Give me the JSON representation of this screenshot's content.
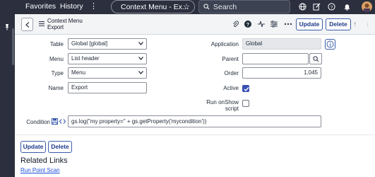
{
  "topnav": {
    "favorites": "Favorites",
    "history": "History",
    "more": "⋮",
    "record_title": "Context Menu - Ex...",
    "search_placeholder": "Search"
  },
  "header": {
    "title_line1": "Context Menu",
    "title_line2": "Export",
    "update_label": "Update",
    "delete_label": "Delete"
  },
  "form": {
    "table": {
      "label": "Table",
      "value": "Global [global]"
    },
    "menu": {
      "label": "Menu",
      "value": "List header"
    },
    "type": {
      "label": "Type",
      "value": "Menu"
    },
    "name": {
      "label": "Name",
      "value": "Export"
    },
    "application": {
      "label": "Application",
      "value": "Global"
    },
    "parent": {
      "label": "Parent",
      "value": ""
    },
    "order": {
      "label": "Order",
      "value": "1,045"
    },
    "active": {
      "label": "Active",
      "checked": true
    },
    "run_onshow": {
      "label_line1": "Run onShow",
      "label_line2": "script",
      "checked": false
    },
    "condition": {
      "label": "Condition",
      "value": "gs.log(\"my property=\" + gs.getProperty('mycondition'))"
    }
  },
  "footer": {
    "update_label": "Update",
    "delete_label": "Delete"
  },
  "related_links": {
    "title": "Related Links",
    "items": [
      "Run Point Scan"
    ]
  },
  "colors": {
    "nav_bg": "#2b2f3e",
    "accent": "#3b52b4",
    "button_border": "#3b5cab"
  }
}
